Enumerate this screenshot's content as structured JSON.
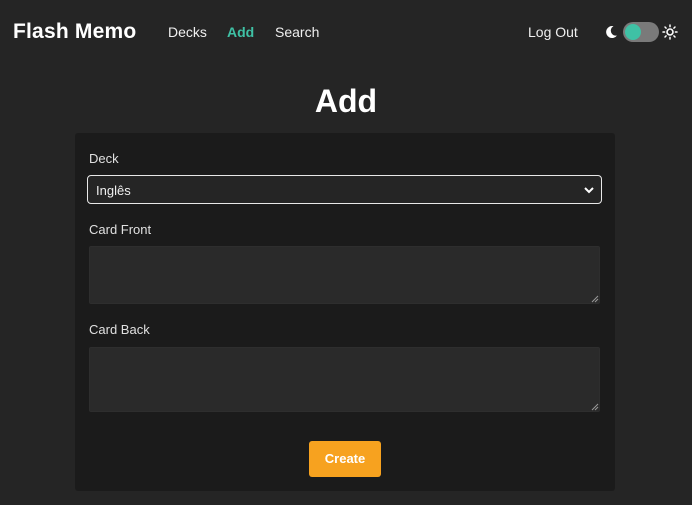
{
  "navbar": {
    "brand": "Flash Memo",
    "links": [
      {
        "label": "Decks",
        "active": false
      },
      {
        "label": "Add",
        "active": true
      },
      {
        "label": "Search",
        "active": false
      }
    ],
    "logout_label": "Log Out",
    "theme_toggle": {
      "left_icon": "moon-icon",
      "right_icon": "sun-icon",
      "state": "dark"
    }
  },
  "page": {
    "title": "Add"
  },
  "form": {
    "deck_label": "Deck",
    "deck_selected": "Inglês",
    "card_front_label": "Card Front",
    "card_front_value": "",
    "card_back_label": "Card Back",
    "card_back_value": "",
    "create_label": "Create"
  },
  "colors": {
    "accent": "#3fc1a5",
    "button": "#f7a21f",
    "background": "#252525",
    "card": "#1b1b1b"
  }
}
